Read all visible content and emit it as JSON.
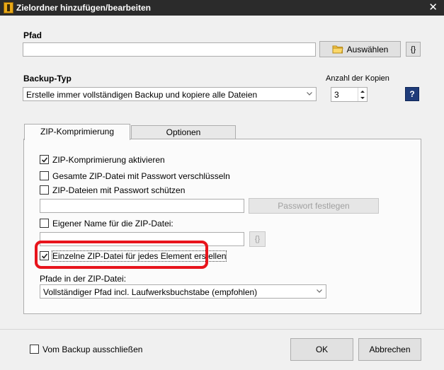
{
  "window": {
    "title": "Zielordner hinzufügen/bearbeiten",
    "close_glyph": "✕"
  },
  "path": {
    "label": "Pfad",
    "value": "",
    "browse_label": "Auswählen",
    "vars_label": "{}"
  },
  "backup_type": {
    "label": "Backup-Typ",
    "selected": "Erstelle immer vollständigen Backup und kopiere alle Dateien",
    "copies_label": "Anzahl der Kopien",
    "copies_value": "3",
    "help_label": "?"
  },
  "tabs": [
    {
      "label": "ZIP-Komprimierung",
      "active": true
    },
    {
      "label": "Optionen",
      "active": false
    }
  ],
  "zip": {
    "enable": {
      "label": "ZIP-Komprimierung aktivieren",
      "checked": true
    },
    "encrypt_all": {
      "label": "Gesamte ZIP-Datei mit Passwort verschlüsseln",
      "checked": false
    },
    "protect": {
      "label": "ZIP-Dateien mit Passwort schützen",
      "checked": false
    },
    "password_value": "",
    "set_password_label": "Passwort festlegen",
    "custom_name": {
      "label": "Eigener Name für die ZIP-Datei:",
      "checked": false
    },
    "custom_name_value": "",
    "custom_name_vars_label": "{}",
    "per_element": {
      "label": "Einzelne ZIP-Datei für jedes Element erstellen",
      "checked": true
    },
    "paths_label": "Pfade in der ZIP-Datei:",
    "paths_selected": "Vollständiger Pfad incl. Laufwerksbuchstabe (empfohlen)"
  },
  "footer": {
    "exclude": {
      "label": "Vom Backup ausschließen",
      "checked": false
    },
    "ok_label": "OK",
    "cancel_label": "Abbrechen"
  },
  "colors": {
    "titlebar": "#2b2b2b",
    "highlight": "#e8141c",
    "help": "#1f3c7a"
  },
  "icons": [
    "app-icon",
    "close-icon",
    "folder-icon",
    "chevron-down-icon",
    "spin-up-icon",
    "spin-down-icon",
    "help-icon",
    "check-icon"
  ]
}
